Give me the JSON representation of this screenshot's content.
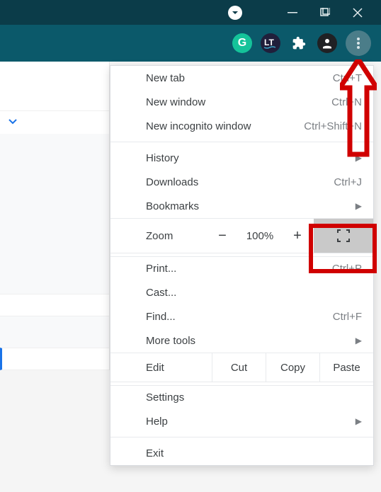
{
  "titlebar": {
    "minimize": "minimize",
    "maximize": "maximize",
    "close": "close"
  },
  "toolbar": {
    "grammarly": "G",
    "lt": "LT",
    "extensions": "extensions",
    "profile": "profile",
    "menu": "menu"
  },
  "menu": {
    "new_tab": {
      "label": "New tab",
      "shortcut": "Ctrl+T"
    },
    "new_window": {
      "label": "New window",
      "shortcut": "Ctrl+N"
    },
    "new_incognito": {
      "label": "New incognito window",
      "shortcut": "Ctrl+Shift+N"
    },
    "history": {
      "label": "History"
    },
    "downloads": {
      "label": "Downloads",
      "shortcut": "Ctrl+J"
    },
    "bookmarks": {
      "label": "Bookmarks"
    },
    "zoom": {
      "label": "Zoom",
      "value": "100%",
      "minus": "−",
      "plus": "+"
    },
    "print": {
      "label": "Print...",
      "shortcut": "Ctrl+P"
    },
    "cast": {
      "label": "Cast..."
    },
    "find": {
      "label": "Find...",
      "shortcut": "Ctrl+F"
    },
    "more_tools": {
      "label": "More tools"
    },
    "edit": {
      "label": "Edit",
      "cut": "Cut",
      "copy": "Copy",
      "paste": "Paste"
    },
    "settings": {
      "label": "Settings"
    },
    "help": {
      "label": "Help"
    },
    "exit": {
      "label": "Exit"
    }
  }
}
